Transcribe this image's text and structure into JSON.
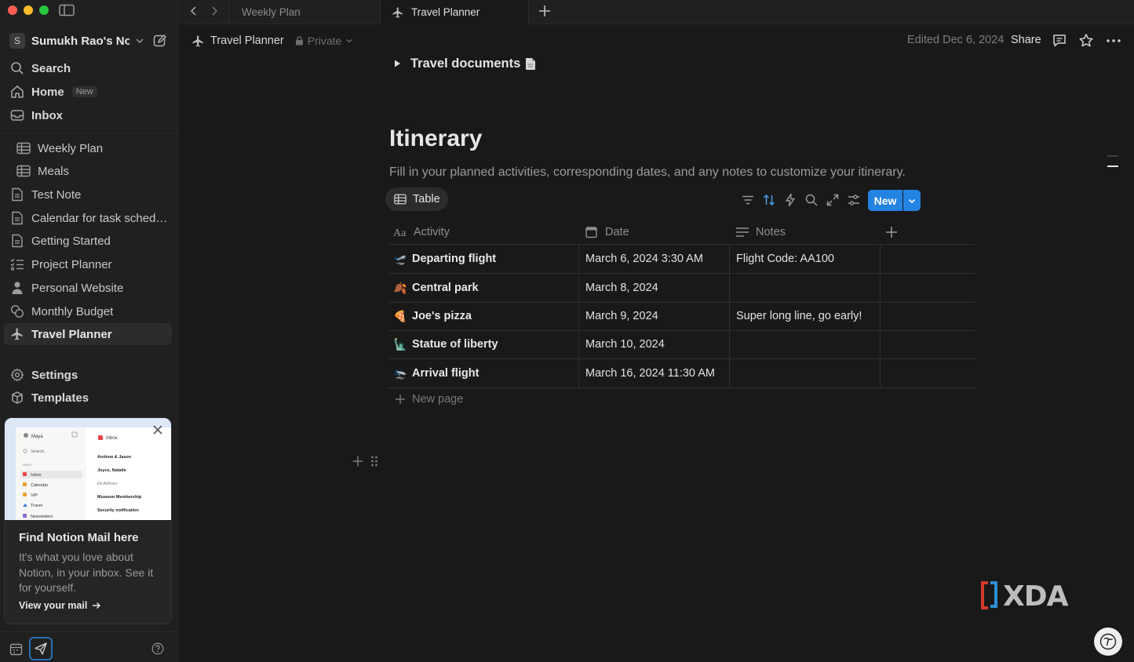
{
  "window": {
    "colors": {
      "close": "#ff5f57",
      "minimize": "#febc2e",
      "maximize": "#28c840",
      "accent": "#2383e2"
    }
  },
  "tabs": [
    {
      "label": "Weekly Plan"
    },
    {
      "label": "Travel Planner",
      "icon": "airplane-icon",
      "active": true
    }
  ],
  "sidebar": {
    "workspace": {
      "initial": "S",
      "name": "Sumukh Rao's No..."
    },
    "top_items": [
      {
        "label": "Search",
        "icon": "search-icon"
      },
      {
        "label": "Home",
        "icon": "home-icon",
        "badge": "New"
      },
      {
        "label": "Inbox",
        "icon": "inbox-icon"
      }
    ],
    "pages": [
      {
        "label": "Weekly Plan",
        "icon": "table-icon"
      },
      {
        "label": "Meals",
        "icon": "table-icon"
      },
      {
        "label": "Test Note",
        "icon": "page-icon"
      },
      {
        "label": "Calendar for task schedu...",
        "icon": "page-icon"
      },
      {
        "label": "Getting Started",
        "icon": "page-icon"
      },
      {
        "label": "Project Planner",
        "icon": "checklist-icon"
      },
      {
        "label": "Personal Website",
        "icon": "person-icon"
      },
      {
        "label": "Monthly Budget",
        "icon": "coins-icon"
      },
      {
        "label": "Travel Planner",
        "icon": "airplane-icon",
        "active": true
      }
    ],
    "bottom_items": [
      {
        "label": "Settings",
        "icon": "gear-icon"
      },
      {
        "label": "Templates",
        "icon": "templates-icon"
      }
    ],
    "promo": {
      "title": "Find Notion Mail here",
      "description": "It's what you love about Notion, in your inbox. See it for yourself.",
      "link": "View your mail",
      "preview": {
        "account": "Maya",
        "search": "Search",
        "section": "Views",
        "folders": [
          "Inbox",
          "Calendar",
          "VIP",
          "Travel",
          "Newsletters"
        ],
        "header": "Inbox",
        "senders": [
          "Andrew & Jason",
          "Joyce, Natalie",
          "Eli Airlines",
          "Museum Membership",
          "Security notification"
        ]
      }
    }
  },
  "topbar": {
    "page_title": "Travel Planner",
    "privacy": "Private",
    "edited": "Edited Dec 6, 2024",
    "share": "Share"
  },
  "page": {
    "toggle_label": "Travel documents",
    "heading": "Itinerary",
    "subtitle": "Fill in your planned activities, corresponding dates, and any notes to customize your itinerary."
  },
  "database": {
    "view_label": "Table",
    "new_button": "New",
    "columns": [
      {
        "label": "Activity",
        "icon": "title-icon"
      },
      {
        "label": "Date",
        "icon": "calendar-icon"
      },
      {
        "label": "Notes",
        "icon": "text-icon"
      }
    ],
    "rows": [
      {
        "activity": "Departing flight",
        "emoji": "🛫",
        "date": "March 6, 2024 3:30 AM",
        "notes": "Flight Code: AA100"
      },
      {
        "activity": "Central park",
        "emoji": "🍂",
        "date": "March 8, 2024",
        "notes": ""
      },
      {
        "activity": "Joe's pizza",
        "emoji": "🍕",
        "date": "March 9, 2024",
        "notes": "Super long line, go early!"
      },
      {
        "activity": "Statue of liberty",
        "emoji": "🗽",
        "date": "March 10, 2024",
        "notes": ""
      },
      {
        "activity": "Arrival flight",
        "emoji": "🛬",
        "date": "March 16, 2024 11:30 AM",
        "notes": ""
      }
    ],
    "new_page_label": "New page"
  }
}
